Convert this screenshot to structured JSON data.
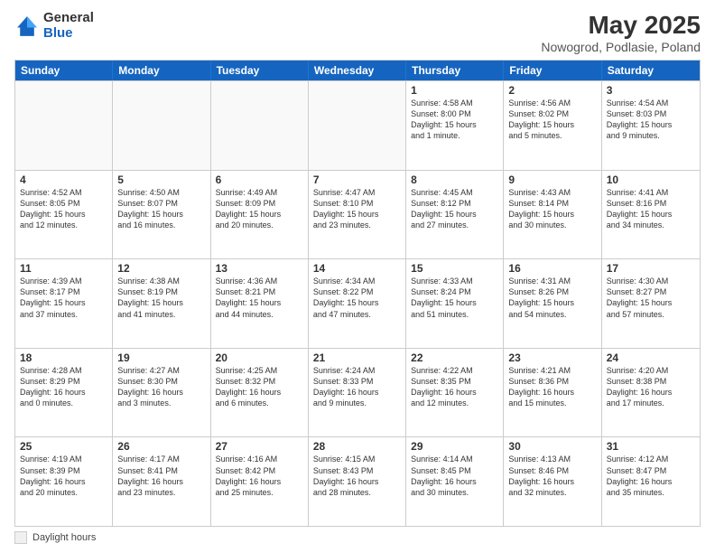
{
  "header": {
    "logo": {
      "general": "General",
      "blue": "Blue"
    },
    "title": "May 2025",
    "location": "Nowogrod, Podlasie, Poland"
  },
  "weekdays": [
    "Sunday",
    "Monday",
    "Tuesday",
    "Wednesday",
    "Thursday",
    "Friday",
    "Saturday"
  ],
  "weeks": [
    [
      {
        "day": "",
        "text": "",
        "empty": true
      },
      {
        "day": "",
        "text": "",
        "empty": true
      },
      {
        "day": "",
        "text": "",
        "empty": true
      },
      {
        "day": "",
        "text": "",
        "empty": true
      },
      {
        "day": "1",
        "text": "Sunrise: 4:58 AM\nSunset: 8:00 PM\nDaylight: 15 hours\nand 1 minute.",
        "empty": false
      },
      {
        "day": "2",
        "text": "Sunrise: 4:56 AM\nSunset: 8:02 PM\nDaylight: 15 hours\nand 5 minutes.",
        "empty": false
      },
      {
        "day": "3",
        "text": "Sunrise: 4:54 AM\nSunset: 8:03 PM\nDaylight: 15 hours\nand 9 minutes.",
        "empty": false
      }
    ],
    [
      {
        "day": "4",
        "text": "Sunrise: 4:52 AM\nSunset: 8:05 PM\nDaylight: 15 hours\nand 12 minutes.",
        "empty": false
      },
      {
        "day": "5",
        "text": "Sunrise: 4:50 AM\nSunset: 8:07 PM\nDaylight: 15 hours\nand 16 minutes.",
        "empty": false
      },
      {
        "day": "6",
        "text": "Sunrise: 4:49 AM\nSunset: 8:09 PM\nDaylight: 15 hours\nand 20 minutes.",
        "empty": false
      },
      {
        "day": "7",
        "text": "Sunrise: 4:47 AM\nSunset: 8:10 PM\nDaylight: 15 hours\nand 23 minutes.",
        "empty": false
      },
      {
        "day": "8",
        "text": "Sunrise: 4:45 AM\nSunset: 8:12 PM\nDaylight: 15 hours\nand 27 minutes.",
        "empty": false
      },
      {
        "day": "9",
        "text": "Sunrise: 4:43 AM\nSunset: 8:14 PM\nDaylight: 15 hours\nand 30 minutes.",
        "empty": false
      },
      {
        "day": "10",
        "text": "Sunrise: 4:41 AM\nSunset: 8:16 PM\nDaylight: 15 hours\nand 34 minutes.",
        "empty": false
      }
    ],
    [
      {
        "day": "11",
        "text": "Sunrise: 4:39 AM\nSunset: 8:17 PM\nDaylight: 15 hours\nand 37 minutes.",
        "empty": false
      },
      {
        "day": "12",
        "text": "Sunrise: 4:38 AM\nSunset: 8:19 PM\nDaylight: 15 hours\nand 41 minutes.",
        "empty": false
      },
      {
        "day": "13",
        "text": "Sunrise: 4:36 AM\nSunset: 8:21 PM\nDaylight: 15 hours\nand 44 minutes.",
        "empty": false
      },
      {
        "day": "14",
        "text": "Sunrise: 4:34 AM\nSunset: 8:22 PM\nDaylight: 15 hours\nand 47 minutes.",
        "empty": false
      },
      {
        "day": "15",
        "text": "Sunrise: 4:33 AM\nSunset: 8:24 PM\nDaylight: 15 hours\nand 51 minutes.",
        "empty": false
      },
      {
        "day": "16",
        "text": "Sunrise: 4:31 AM\nSunset: 8:26 PM\nDaylight: 15 hours\nand 54 minutes.",
        "empty": false
      },
      {
        "day": "17",
        "text": "Sunrise: 4:30 AM\nSunset: 8:27 PM\nDaylight: 15 hours\nand 57 minutes.",
        "empty": false
      }
    ],
    [
      {
        "day": "18",
        "text": "Sunrise: 4:28 AM\nSunset: 8:29 PM\nDaylight: 16 hours\nand 0 minutes.",
        "empty": false
      },
      {
        "day": "19",
        "text": "Sunrise: 4:27 AM\nSunset: 8:30 PM\nDaylight: 16 hours\nand 3 minutes.",
        "empty": false
      },
      {
        "day": "20",
        "text": "Sunrise: 4:25 AM\nSunset: 8:32 PM\nDaylight: 16 hours\nand 6 minutes.",
        "empty": false
      },
      {
        "day": "21",
        "text": "Sunrise: 4:24 AM\nSunset: 8:33 PM\nDaylight: 16 hours\nand 9 minutes.",
        "empty": false
      },
      {
        "day": "22",
        "text": "Sunrise: 4:22 AM\nSunset: 8:35 PM\nDaylight: 16 hours\nand 12 minutes.",
        "empty": false
      },
      {
        "day": "23",
        "text": "Sunrise: 4:21 AM\nSunset: 8:36 PM\nDaylight: 16 hours\nand 15 minutes.",
        "empty": false
      },
      {
        "day": "24",
        "text": "Sunrise: 4:20 AM\nSunset: 8:38 PM\nDaylight: 16 hours\nand 17 minutes.",
        "empty": false
      }
    ],
    [
      {
        "day": "25",
        "text": "Sunrise: 4:19 AM\nSunset: 8:39 PM\nDaylight: 16 hours\nand 20 minutes.",
        "empty": false
      },
      {
        "day": "26",
        "text": "Sunrise: 4:17 AM\nSunset: 8:41 PM\nDaylight: 16 hours\nand 23 minutes.",
        "empty": false
      },
      {
        "day": "27",
        "text": "Sunrise: 4:16 AM\nSunset: 8:42 PM\nDaylight: 16 hours\nand 25 minutes.",
        "empty": false
      },
      {
        "day": "28",
        "text": "Sunrise: 4:15 AM\nSunset: 8:43 PM\nDaylight: 16 hours\nand 28 minutes.",
        "empty": false
      },
      {
        "day": "29",
        "text": "Sunrise: 4:14 AM\nSunset: 8:45 PM\nDaylight: 16 hours\nand 30 minutes.",
        "empty": false
      },
      {
        "day": "30",
        "text": "Sunrise: 4:13 AM\nSunset: 8:46 PM\nDaylight: 16 hours\nand 32 minutes.",
        "empty": false
      },
      {
        "day": "31",
        "text": "Sunrise: 4:12 AM\nSunset: 8:47 PM\nDaylight: 16 hours\nand 35 minutes.",
        "empty": false
      }
    ]
  ],
  "legend": {
    "box_label": "Daylight hours"
  }
}
